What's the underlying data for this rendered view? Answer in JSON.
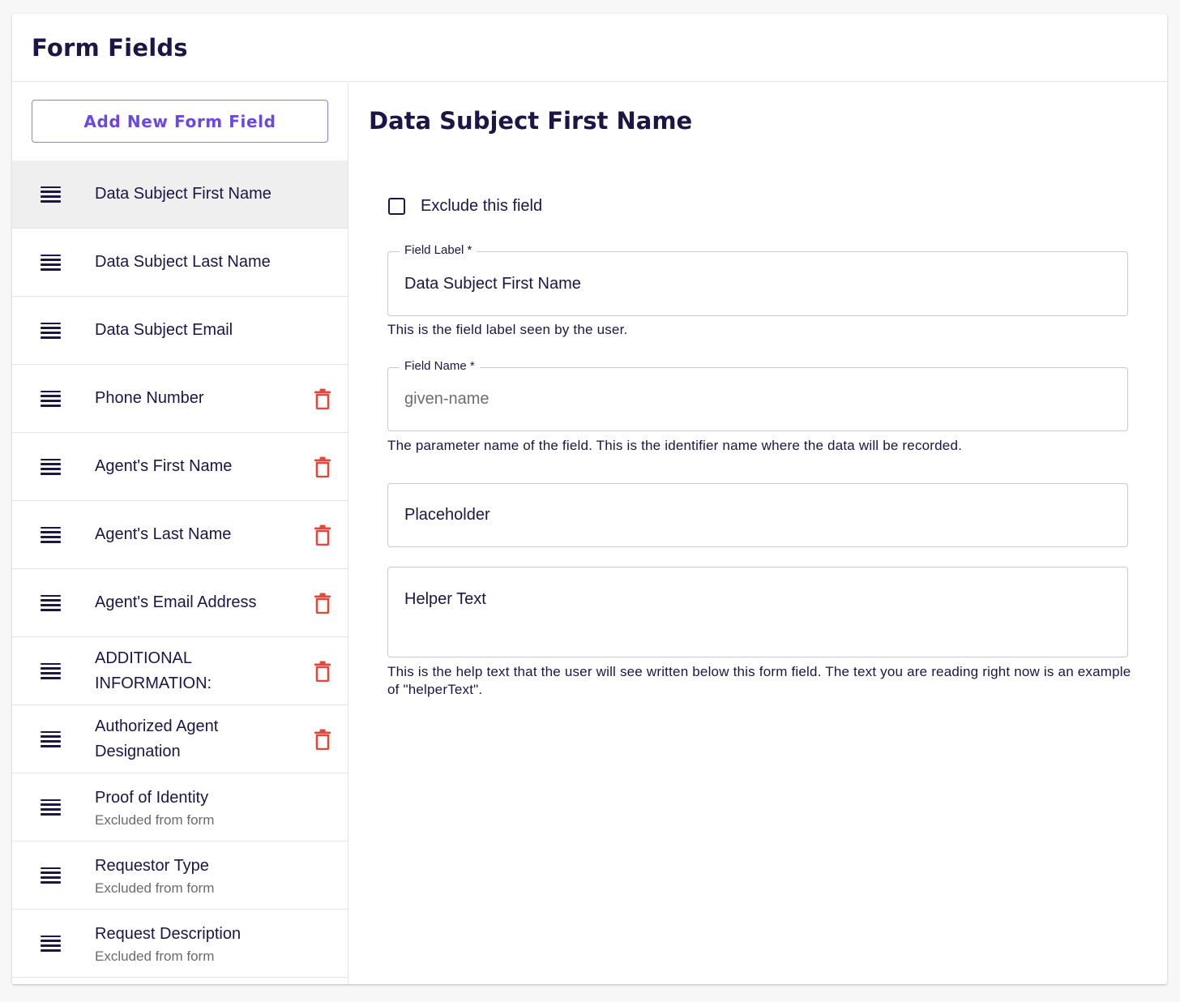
{
  "page": {
    "title": "Form Fields"
  },
  "sidebar": {
    "add_button_label": "Add New Form Field",
    "items": [
      {
        "label": "Data Subject First Name",
        "sub": "",
        "deletable": false,
        "selected": true
      },
      {
        "label": "Data Subject Last Name",
        "sub": "",
        "deletable": false,
        "selected": false
      },
      {
        "label": "Data Subject Email",
        "sub": "",
        "deletable": false,
        "selected": false
      },
      {
        "label": "Phone Number",
        "sub": "",
        "deletable": true,
        "selected": false
      },
      {
        "label": "Agent's First Name",
        "sub": "",
        "deletable": true,
        "selected": false
      },
      {
        "label": "Agent's Last Name",
        "sub": "",
        "deletable": true,
        "selected": false
      },
      {
        "label": "Agent's Email Address",
        "sub": "",
        "deletable": true,
        "selected": false
      },
      {
        "label": "ADDITIONAL INFORMATION:",
        "sub": "",
        "deletable": true,
        "selected": false
      },
      {
        "label": "Authorized Agent Designation",
        "sub": "",
        "deletable": true,
        "selected": false
      },
      {
        "label": "Proof of Identity",
        "sub": "Excluded from form",
        "deletable": false,
        "selected": false
      },
      {
        "label": "Requestor Type",
        "sub": "Excluded from form",
        "deletable": false,
        "selected": false
      },
      {
        "label": "Request Description",
        "sub": "Excluded from form",
        "deletable": false,
        "selected": false
      }
    ]
  },
  "detail": {
    "title": "Data Subject First Name",
    "exclude_label": "Exclude this field",
    "exclude_checked": false,
    "field_label": {
      "legend": "Field Label *",
      "value": "Data Subject First Name",
      "help": "This is the field label seen by the user."
    },
    "field_name": {
      "legend": "Field Name *",
      "value": "given-name",
      "help": "The parameter name of the field. This is the identifier name where the data will be recorded."
    },
    "placeholder": {
      "placeholder": "Placeholder",
      "value": ""
    },
    "helper_text": {
      "placeholder": "Helper Text",
      "value": "",
      "help": "This is the help text that the user will see written below this form field. The text you are reading right now is an example of \"helperText\"."
    }
  },
  "colors": {
    "primary_text": "#1c1546",
    "accent": "#6a47e6",
    "delete": "#e0483c",
    "selected_row": "#efefef"
  }
}
